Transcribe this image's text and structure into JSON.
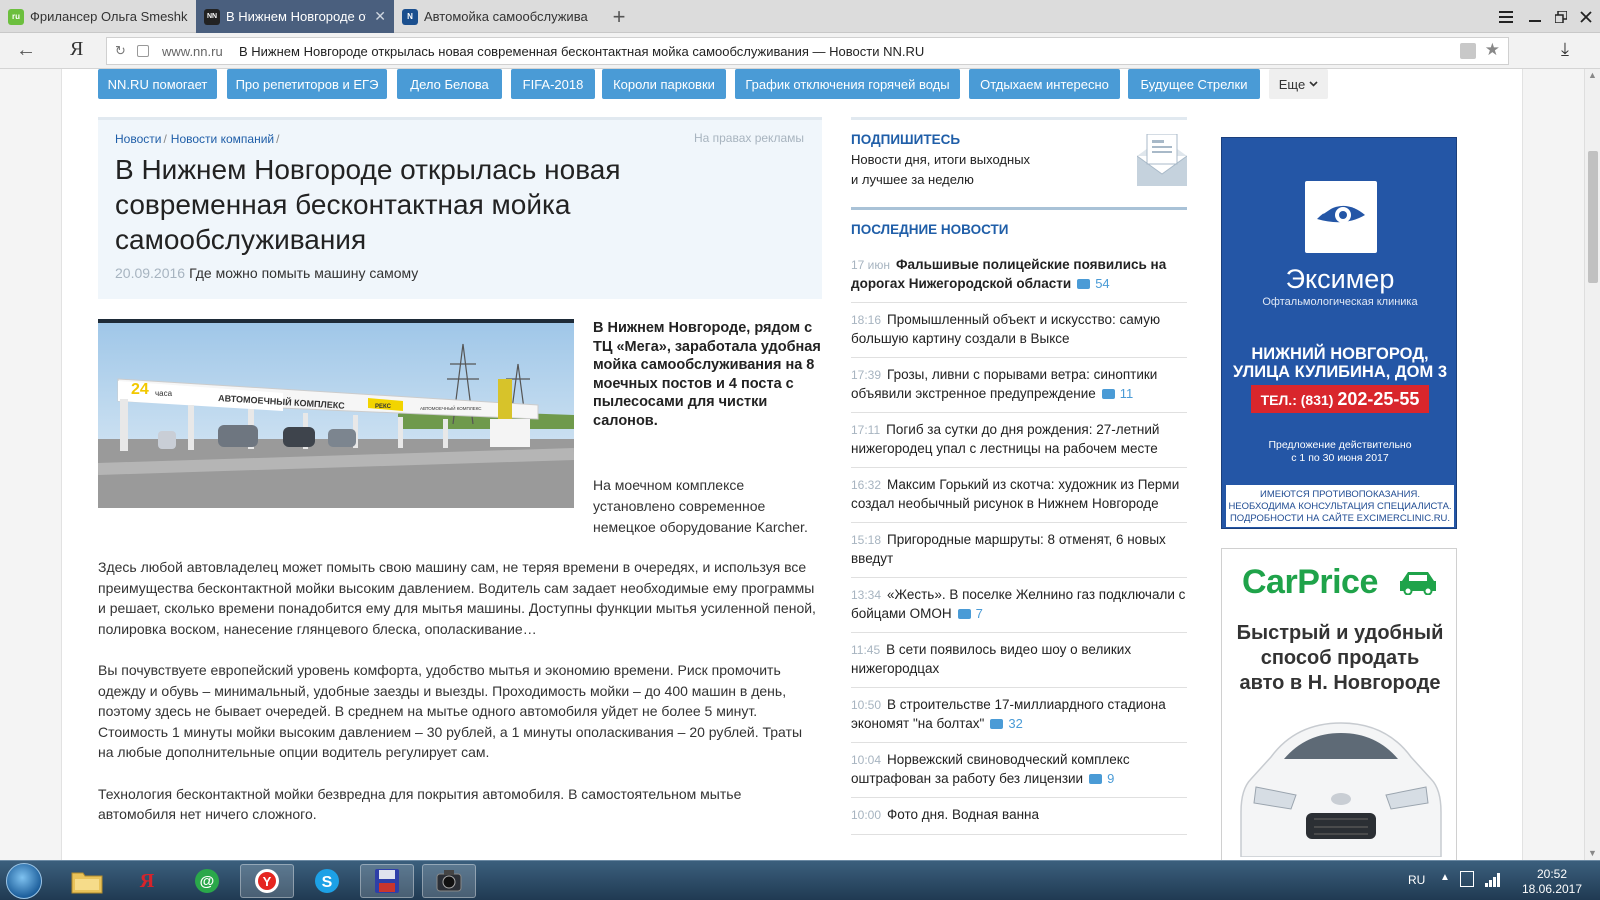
{
  "browser": {
    "tabs": [
      {
        "title": "Фрилансер Ольга Smeshka",
        "favicon": "fl-icon",
        "active": false
      },
      {
        "title": "В Нижнем Новгороде от",
        "favicon": "nn-icon",
        "active": true
      },
      {
        "title": "Автомойка самообслужива",
        "favicon": "n-icon",
        "active": false
      }
    ],
    "new_tab": "+",
    "address": {
      "domain": "www.nn.ru",
      "title": "В Нижнем Новгороде открылась новая современная бесконтактная мойка самообслуживания — Новости NN.RU"
    }
  },
  "tags": [
    "NN.RU помогает",
    "Про репетиторов и ЕГЭ",
    "Дело Белова",
    "FIFA-2018",
    "Короли парковки",
    "График отключения горячей воды",
    "Отдыхаем интересно",
    "Будущее Стрелки"
  ],
  "tags_more": "Еще",
  "article": {
    "breadcrumbs": [
      "Новости",
      "Новости компаний"
    ],
    "ad_note": "На правах рекламы",
    "title": "В Нижнем Новгороде открылась новая современная бесконтактная мойка самообслуживания",
    "date": "20.09.2016",
    "subtitle": "Где можно помыть машину самому",
    "photo": {
      "sign_24": "24",
      "sign_hours": "часа",
      "sign_main": "АВТОМОЕЧНЫЙ КОМПЛЕКС",
      "sign_brand": "РЕКС",
      "sign_small": "АВТОМОЕЧНЫЙ КОМПЛЕКС"
    },
    "lead": "В Нижнем Новгороде, рядом с ТЦ «Мега», заработала удобная мойка самообслуживания на 8 моечных постов и 4 поста с пылесосами для чистки салонов.",
    "side_para": "На моечном комплексе установлено современное немецкое оборудование Karcher.",
    "paragraphs": [
      "Здесь любой автовладелец может помыть свою машину сам, не теряя времени в очередях, и используя все преимущества бесконтактной мойки высоким давлением. Водитель сам задает необходимые ему программы и решает, сколько времени понадобится ему для мытья машины. Доступны функции мытья усиленной пеной, полировка воском, нанесение глянцевого блеска, ополаскивание…",
      "Вы почувствуете европейский уровень комфорта, удобство мытья и экономию времени. Риск промочить одежду и обувь – минимальный, удобные заезды и выезды. Проходимость мойки – до 400 машин в день, поэтому здесь не бывает очередей. В среднем на мытье одного автомобиля уйдет не более 5 минут. Стоимость 1 минуты мойки высоким давлением – 30 рублей, а 1 минуты ополаскивания – 20 рублей. Траты на любые дополнительные опции водитель регулирует сам.",
      "Технология бесконтактной мойки безвредна для покрытия автомобиля. В самостоятельном мытье автомобиля нет ничего сложного."
    ]
  },
  "subscribe": {
    "title": "ПОДПИШИТЕСЬ",
    "line1": "Новости дня, итоги выходных",
    "line2": "и лучшее за неделю"
  },
  "latest": {
    "title": "ПОСЛЕДНИЕ НОВОСТИ",
    "items": [
      {
        "time": "17 июн",
        "headline": "Фальшивые полицейские появились на дорогах Нижегородской области",
        "comments": "54",
        "bold": true
      },
      {
        "time": "18:16",
        "headline": "Промышленный объект и искусство: самую большую картину создали в Выксе",
        "comments": "",
        "bold": false
      },
      {
        "time": "17:39",
        "headline": "Грозы, ливни с порывами ветра: синоптики объявили экстренное предупреждение",
        "comments": "11",
        "bold": false
      },
      {
        "time": "17:11",
        "headline": "Погиб за сутки до дня рождения: 27-летний нижегородец упал с лестницы на рабочем месте",
        "comments": "",
        "bold": false
      },
      {
        "time": "16:32",
        "headline": "Максим Горький из скотча: художник из Перми создал необычный рисунок в Нижнем Новгороде",
        "comments": "",
        "bold": false
      },
      {
        "time": "15:18",
        "headline": "Пригородные маршруты: 8 отменят, 6 новых введут",
        "comments": "",
        "bold": false
      },
      {
        "time": "13:34",
        "headline": "«Жесть». В поселке Желнино газ подключали с бойцами ОМОН",
        "comments": "7",
        "bold": false
      },
      {
        "time": "11:45",
        "headline": "В сети появилось видео шоу о великих нижегородцах",
        "comments": "",
        "bold": false
      },
      {
        "time": "10:50",
        "headline": "В строительстве 17-миллиардного стадиона экономят \"на болтах\"",
        "comments": "32",
        "bold": false
      },
      {
        "time": "10:04",
        "headline": "Норвежский свиноводческий комплекс оштрафован за работу без лицензии",
        "comments": "9",
        "bold": false
      },
      {
        "time": "10:00",
        "headline": "Фото дня. Водная ванна",
        "comments": "",
        "bold": false
      }
    ]
  },
  "ads": {
    "eximer": {
      "brand": "Эксимер",
      "sub": "Офтальмологическая клиника",
      "addr1": "НИЖНИЙ НОВГОРОД,",
      "addr2": "УЛИЦА КУЛИБИНА, ДОМ 3",
      "tel_prefix": "ТЕЛ.: (831)",
      "tel_number": "202-25-55",
      "offer1": "Предложение действительно",
      "offer2": "с 1 по 30 июня 2017",
      "warn1": "ИМЕЮТСЯ ПРОТИВОПОКАЗАНИЯ.",
      "warn2": "НЕОБХОДИМА КОНСУЛЬТАЦИЯ СПЕЦИАЛИСТА.",
      "warn3": "ПОДРОБНОСТИ НА САЙТЕ EXCIMERCLINIC.RU."
    },
    "carprice": {
      "brand": "CarPrice",
      "line1": "Быстрый и удобный",
      "line2": "способ продать",
      "line3": "авто в Н. Новгороде"
    }
  },
  "taskbar": {
    "lang": "RU",
    "time": "20:52",
    "date": "18.06.2017"
  },
  "colors": {
    "accent": "#4a9bd6",
    "link": "#1f5ea8",
    "tab_active": "#4a5f7e",
    "eximer_blue": "#2456a6",
    "carprice_green": "#1fa34a"
  }
}
